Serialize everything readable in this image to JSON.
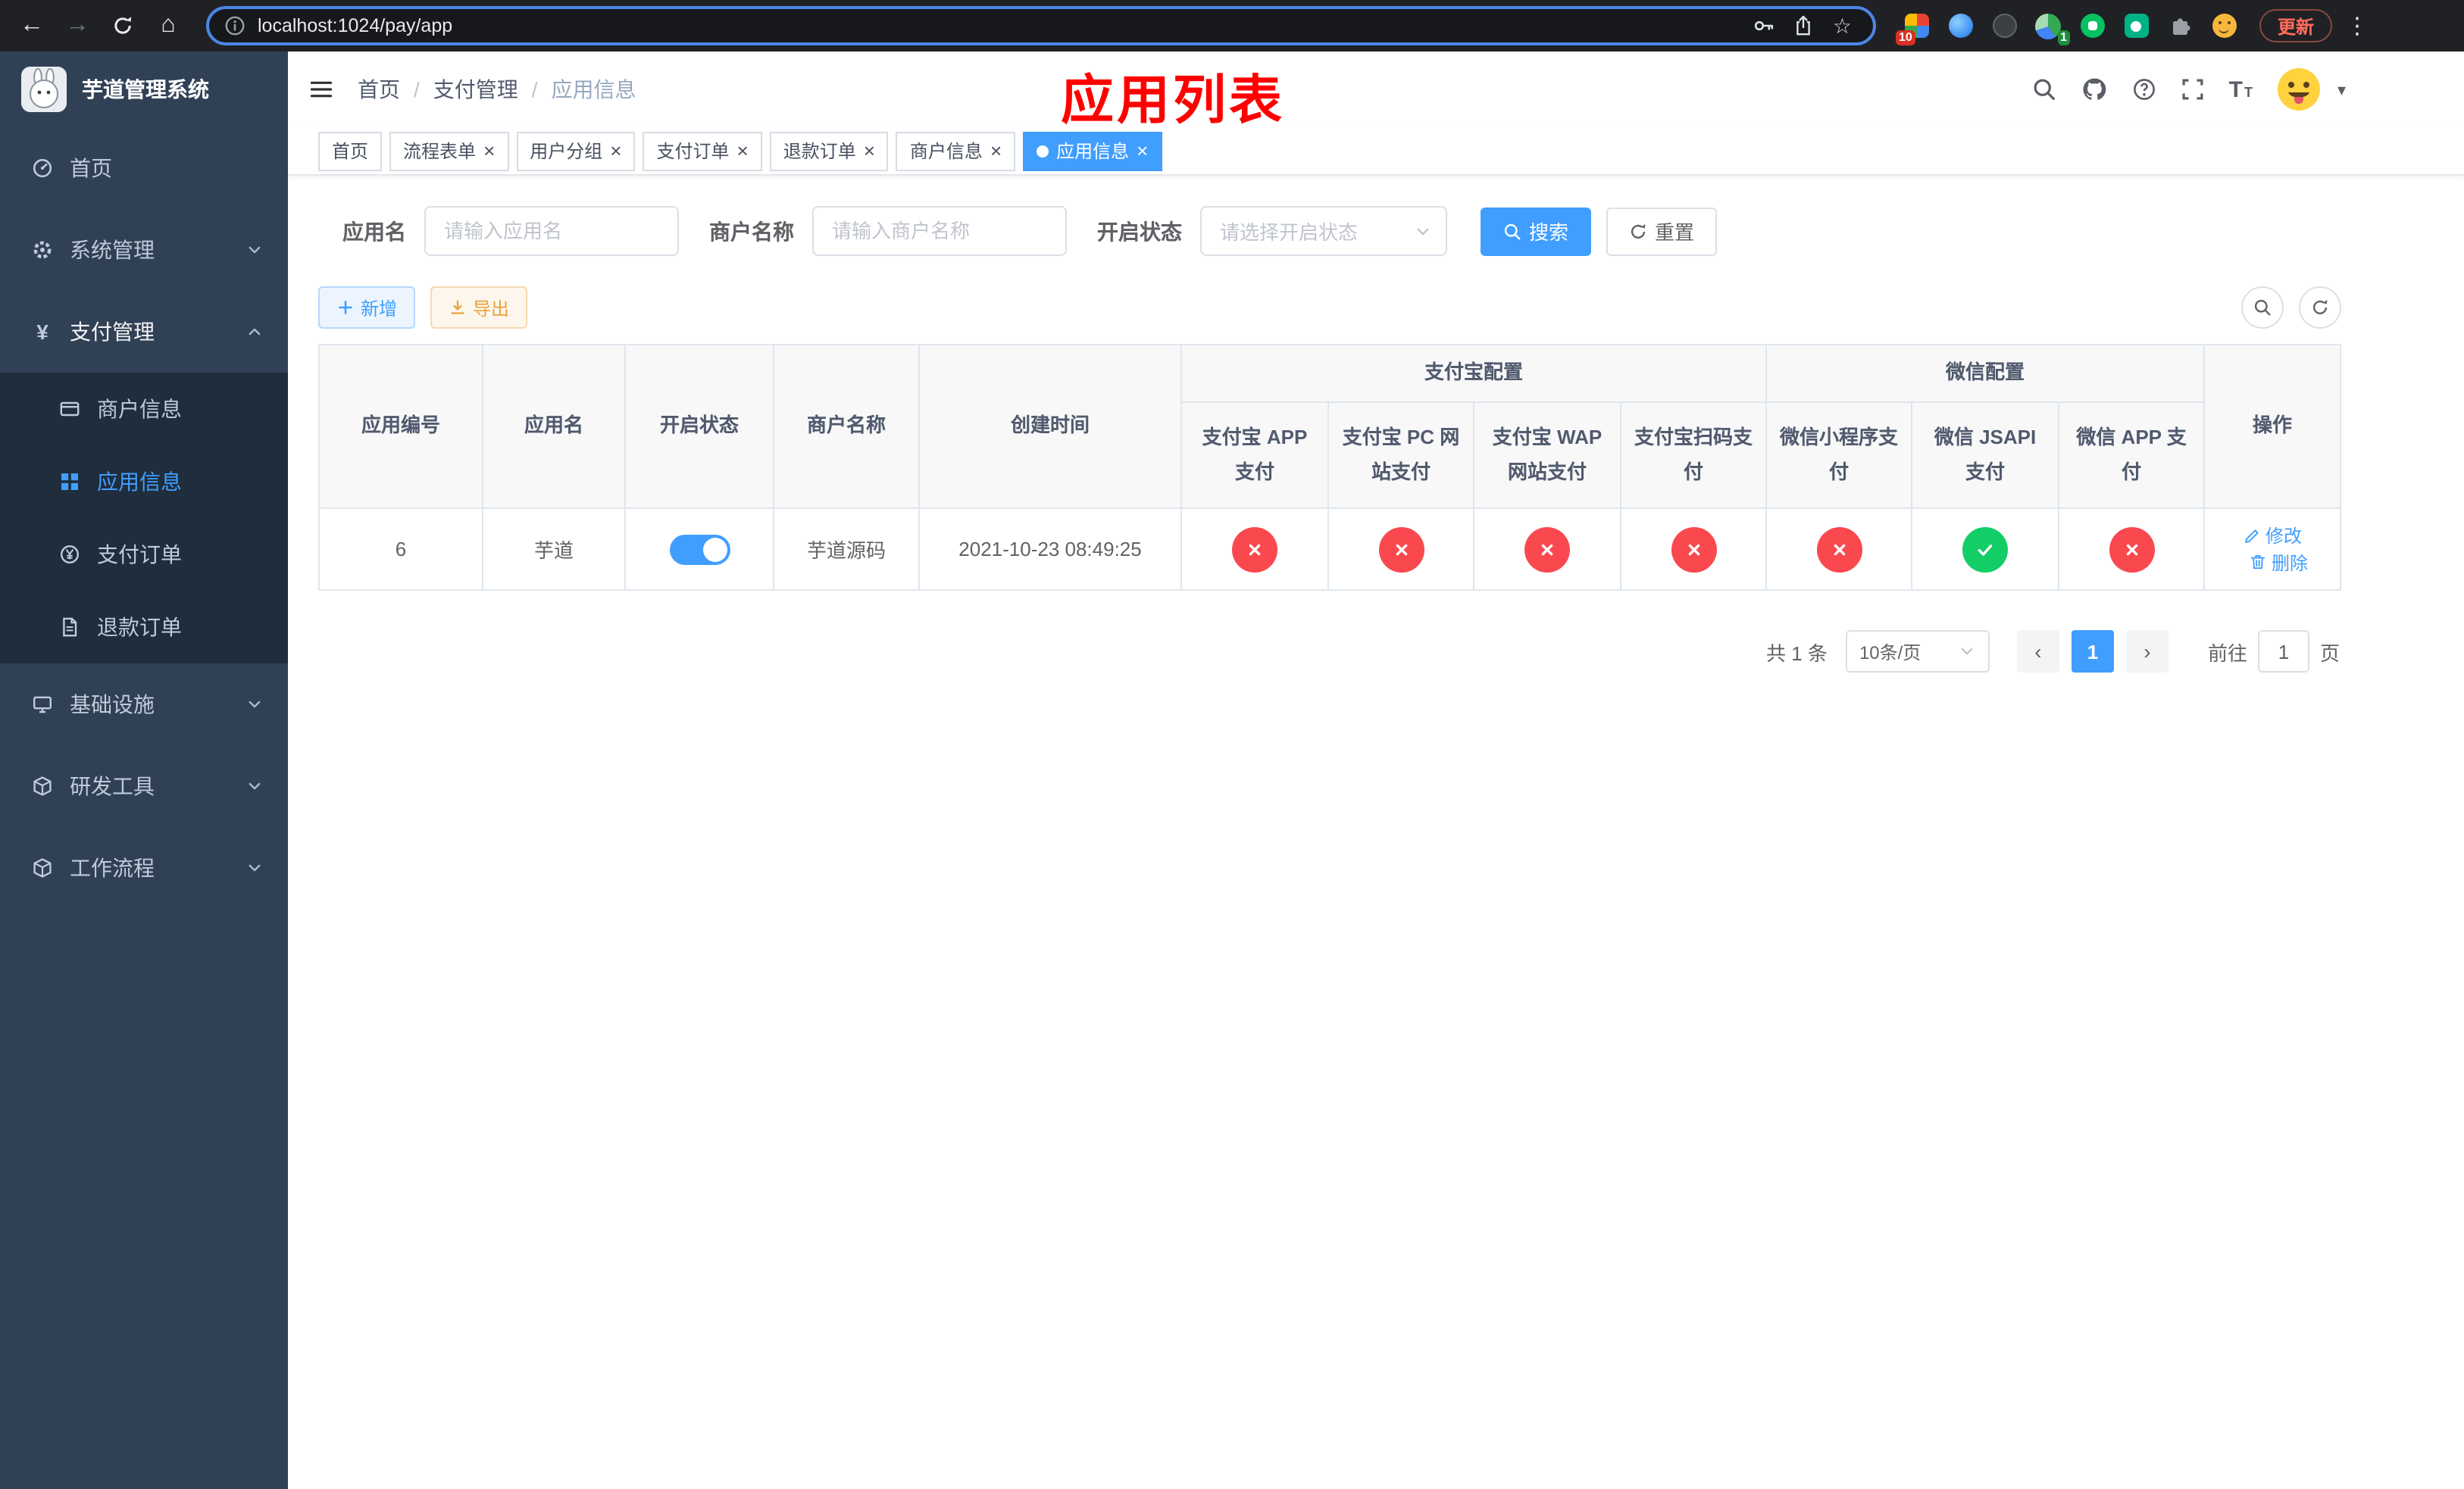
{
  "browser": {
    "url": "localhost:1024/pay/app",
    "update_label": "更新",
    "ext_badge_count": "10",
    "profile_badge_count": "1"
  },
  "icons": {
    "back": "←",
    "forward": "→",
    "home": "⌂",
    "star": "☆",
    "menu_dots": "⋮",
    "caret_down": "▾",
    "slash": "/",
    "prev": "‹",
    "next": "›",
    "close": "×",
    "yen": "¥",
    "font_big": "T",
    "font_small": "T"
  },
  "sidebar": {
    "app_title": "芋道管理系统",
    "menu_home": "首页",
    "menu_system": "系统管理",
    "menu_pay": "支付管理",
    "menu_infra": "基础设施",
    "menu_devtools": "研发工具",
    "menu_workflow": "工作流程",
    "sub_merchant": "商户信息",
    "sub_app": "应用信息",
    "sub_order": "支付订单",
    "sub_refund": "退款订单"
  },
  "header": {
    "breadcrumb": [
      "首页",
      "支付管理",
      "应用信息"
    ],
    "annotation": "应用列表"
  },
  "tabs": [
    {
      "label": "首页",
      "closable": false,
      "active": false
    },
    {
      "label": "流程表单",
      "closable": true,
      "active": false
    },
    {
      "label": "用户分组",
      "closable": true,
      "active": false
    },
    {
      "label": "支付订单",
      "closable": true,
      "active": false
    },
    {
      "label": "退款订单",
      "closable": true,
      "active": false
    },
    {
      "label": "商户信息",
      "closable": true,
      "active": false
    },
    {
      "label": "应用信息",
      "closable": true,
      "active": true
    }
  ],
  "filters": {
    "app_name_label": "应用名",
    "app_name_placeholder": "请输入应用名",
    "merchant_label": "商户名称",
    "merchant_placeholder": "请输入商户名称",
    "status_label": "开启状态",
    "status_placeholder": "请选择开启状态",
    "search_label": "搜索",
    "reset_label": "重置"
  },
  "toolbar": {
    "add_label": "新增",
    "export_label": "导出"
  },
  "table": {
    "group_headers": {
      "alipay": "支付宝配置",
      "wechat": "微信配置"
    },
    "columns": [
      "应用编号",
      "应用名",
      "开启状态",
      "商户名称",
      "创建时间",
      "支付宝 APP 支付",
      "支付宝 PC 网站支付",
      "支付宝 WAP 网站支付",
      "支付宝扫码支付",
      "微信小程序支付",
      "微信 JSAPI 支付",
      "微信 APP 支付",
      "操作"
    ],
    "row": {
      "id": "6",
      "name": "芋道",
      "status_on": true,
      "merchant": "芋道源码",
      "created_at": "2021-10-23 08:49:25",
      "configs": [
        "no",
        "no",
        "no",
        "no",
        "no",
        "yes",
        "no"
      ],
      "edit_label": "修改",
      "delete_label": "删除"
    }
  },
  "pagination": {
    "total": "共 1 条",
    "page_size": "10条/页",
    "current_page": "1",
    "goto_label": "前往",
    "goto_value": "1",
    "page_label": "页"
  },
  "colors": {
    "primary": "#409eff",
    "danger": "#f9494f",
    "success": "#13ce66",
    "annotation": "#ff0000"
  }
}
